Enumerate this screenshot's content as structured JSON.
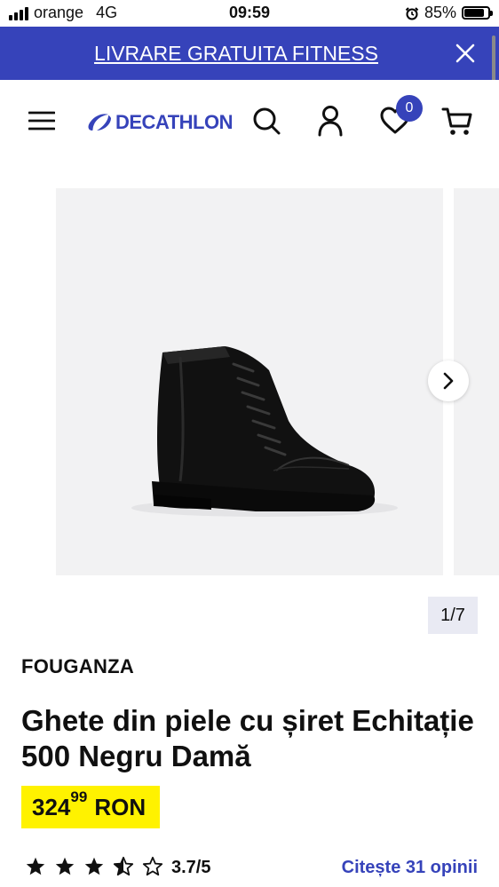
{
  "status_bar": {
    "carrier": "orange",
    "network": "4G",
    "time": "09:59",
    "battery": "85%",
    "battery_level": 0.85
  },
  "promo": {
    "text": "LIVRARE GRATUITA FITNESS"
  },
  "header": {
    "logo_text": "DECATHLON",
    "wishlist_count": "0"
  },
  "gallery": {
    "counter": "1/7"
  },
  "product": {
    "brand": "FOUGANZA",
    "title": "Ghete din piele cu șiret Echitație 500 Negru Damă",
    "price_int": "324",
    "price_dec": "99",
    "currency": "RON",
    "rating": "3.7/5",
    "rating_value": 3.7,
    "reviews_link": "Citește 31 opinii"
  },
  "colors": {
    "brand_blue": "#3643ba",
    "price_yellow": "#fff200"
  }
}
